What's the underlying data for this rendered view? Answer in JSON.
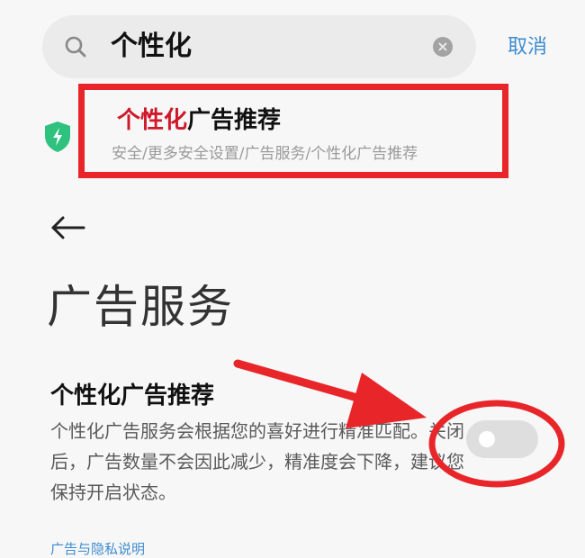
{
  "search": {
    "query": "个性化",
    "cancel_label": "取消"
  },
  "result": {
    "title_highlight": "个性化",
    "title_rest": "广告推荐",
    "path": "安全/更多安全设置/广告服务/个性化广告推荐"
  },
  "page": {
    "title": "广告服务"
  },
  "setting": {
    "title": "个性化广告推荐",
    "description": "个性化广告服务会根据您的喜好进行精准匹配。关闭后，广告数量不会因此减少，精准度会下降，建议您保持开启状态。",
    "enabled": false
  },
  "footer": {
    "link": "广告与隐私说明"
  },
  "colors": {
    "accent": "#3f8ccf",
    "highlight": "#d0182c",
    "annotation": "#e8262a",
    "shield": "#2ec27e"
  },
  "icons": [
    "search-icon",
    "clear-icon",
    "shield-icon",
    "back-arrow-icon"
  ]
}
